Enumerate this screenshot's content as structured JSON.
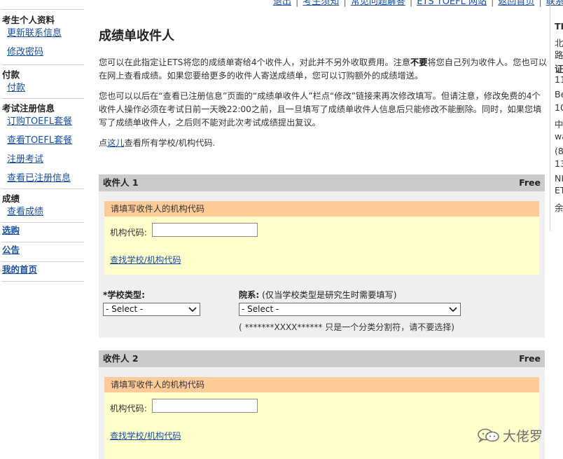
{
  "top_nav": [
    "退出",
    "考生须知",
    "常见问题解答",
    "ETS TOEFL 网站",
    "返回首页",
    "联系我们"
  ],
  "sidebar": {
    "sections": [
      {
        "heading": "考生个人资料",
        "links": [
          "更新联系信息",
          "修改密码"
        ]
      },
      {
        "heading": "付款",
        "links": [
          "付款"
        ]
      },
      {
        "heading": "考试注册信息",
        "links": [
          "订购TOEFL套餐",
          "查看TOEFL套餐",
          "注册考试",
          "查看已注册信息"
        ]
      },
      {
        "heading": "成绩",
        "links": [
          "查看成绩"
        ]
      }
    ],
    "top_links": [
      "选购",
      "公告",
      "我的首页"
    ]
  },
  "main": {
    "title": "成绩单收件人",
    "para1_before": "您可以在此指定让ETS将您的成绩单寄给4个收件人，对此并不另外收取费用。注意",
    "para1_bold": "不要",
    "para1_after": "将您自己列为收件人。您也可以在网上查看成绩。如果您要给更多的收件人寄送成绩单，您可以订购额外的成绩增送。",
    "para2": "您也可以以后在“查看已注册信息”页面的“成绩单收件人”栏点“修改”链接来再次修改填写。但请注意，修改免费的4个收件人操作必须在考试日前一天晚22:00之前，且一旦填写了成绩单收件人信息后只能修改不能删除。同时，如果您填写了成绩单收件人，之后则不能对此次考试成绩提出复议。",
    "para3_before": "点",
    "para3_link": "这儿",
    "para3_after": "查看所有学校/机构代码."
  },
  "recipients": [
    {
      "name": "收件人 1",
      "price": "Free",
      "instruction": "请填写收件人的机构代码",
      "code_label": "机构代码:",
      "code_value": "",
      "find_link": "查找学校/机构代码",
      "school_type_label": "*学校类型:",
      "school_type_value": "- Select -",
      "dept_label": "院系:",
      "dept_hint": "(仅当学校类型是研究生时需要填写)",
      "dept_value": "- Select -",
      "dept_note": "( *******XXXX****** 只是一个分类分割符，请不要选择)"
    },
    {
      "name": "收件人 2",
      "price": "Free",
      "instruction": "请填写收件人的机构代码",
      "code_label": "机构代码:",
      "code_value": "",
      "find_link": "查找学校/机构代码"
    }
  ],
  "right_column": [
    "TI",
    "北",
    "路",
    "证",
    "11",
    "Be",
    "10",
    "中",
    "wa",
    "(8",
    "13",
    "NI",
    "ET",
    "余"
  ],
  "watermark": "大佬罗"
}
